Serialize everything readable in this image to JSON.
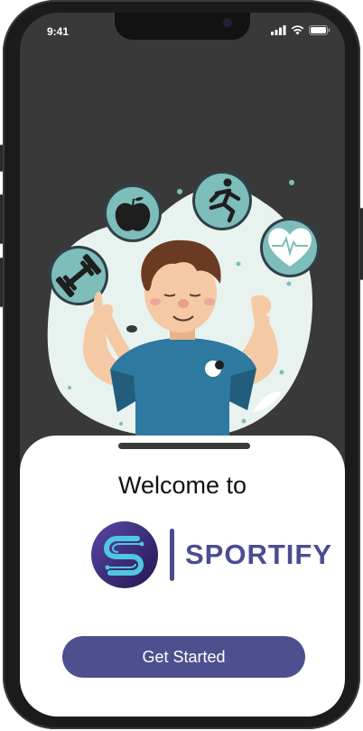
{
  "status_bar": {
    "time": "9:41"
  },
  "welcome": {
    "heading": "Welcome to"
  },
  "brand": {
    "name": "SPORTIFY",
    "color": "#4b4d92"
  },
  "cta": {
    "label": "Get Started",
    "color": "#4e4f8f"
  },
  "icons": [
    "apple-icon",
    "runner-icon",
    "heart-pulse-icon",
    "dumbbell-icon",
    "signal-icon",
    "wifi-icon",
    "battery-icon"
  ],
  "colors": {
    "screen_bg": "#393939",
    "blob": "#e8f3ef",
    "icon_circle": "#7dbdba",
    "sheet": "#ffffff"
  }
}
